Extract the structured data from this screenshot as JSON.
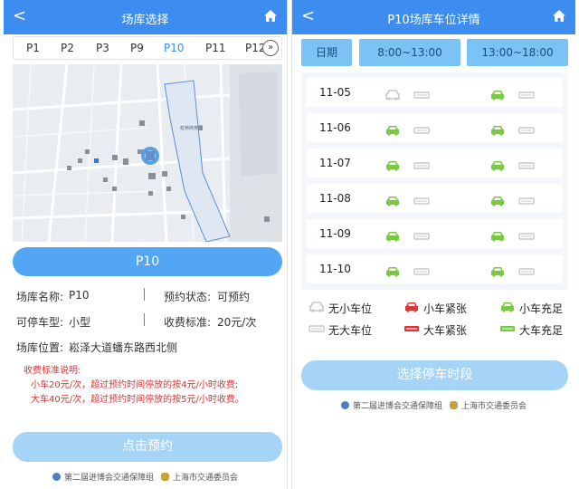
{
  "left": {
    "header": {
      "back": "<",
      "title": "场库选择"
    },
    "tabs": [
      "P1",
      "P2",
      "P3",
      "P9",
      "P10",
      "P11",
      "P12"
    ],
    "active_tab": "P10",
    "more_icon": "»",
    "map": {
      "label": "虹桥商务区"
    },
    "selected_button": "P10",
    "info": {
      "name_label": "场库名称:",
      "name_value": "P10",
      "status_label": "预约状态:",
      "status_value": "可预约",
      "type_label": "可停车型:",
      "type_value": "小型",
      "fee_label": "收费标准:",
      "fee_value": "20元/次",
      "location_label": "场库位置:",
      "location_value": "崧泽大道蟠东路西北侧"
    },
    "notes": {
      "title": "收费标准说明:",
      "line1": "小车20元/次，超过预约时间停放的按4元/小时收费;",
      "line2": "大车40元/次，超过预约时间停放的按5元/小时收费。"
    },
    "book_button": "点击预约",
    "footer": {
      "org1": "第二届进博会交通保障组",
      "org2": "上海市交通委员会"
    }
  },
  "right": {
    "header": {
      "back": "<",
      "title": "P10场库车位详情"
    },
    "col_date": "日期",
    "col_am": "8:00~13:00",
    "col_pm": "13:00~18:00",
    "rows": [
      {
        "date": "11-05",
        "am_small": "none",
        "am_large": "none",
        "pm_small": "ample",
        "pm_large": "none"
      },
      {
        "date": "11-06",
        "am_small": "ample",
        "am_large": "none",
        "pm_small": "ample",
        "pm_large": "none"
      },
      {
        "date": "11-07",
        "am_small": "ample",
        "am_large": "none",
        "pm_small": "ample",
        "pm_large": "none"
      },
      {
        "date": "11-08",
        "am_small": "ample",
        "am_large": "none",
        "pm_small": "ample",
        "pm_large": "none"
      },
      {
        "date": "11-09",
        "am_small": "ample",
        "am_large": "none",
        "pm_small": "ample",
        "pm_large": "none"
      },
      {
        "date": "11-10",
        "am_small": "ample",
        "am_large": "none",
        "pm_small": "ample",
        "pm_large": "none"
      }
    ],
    "legend": {
      "no_small": "无小车位",
      "small_tight": "小车紧张",
      "small_ample": "小车充足",
      "no_large": "无大车位",
      "large_tight": "大车紧张",
      "large_ample": "大车充足"
    },
    "select_button": "选择停车时段",
    "footer": {
      "org1": "第二届进博会交通保障组",
      "org2": "上海市交通委员会"
    }
  },
  "colors": {
    "primary": "#3d8cf0",
    "light_button": "#a6d4f7",
    "ample": "#7ac943",
    "tight": "#d9383a",
    "none": "#c8c8c8"
  }
}
